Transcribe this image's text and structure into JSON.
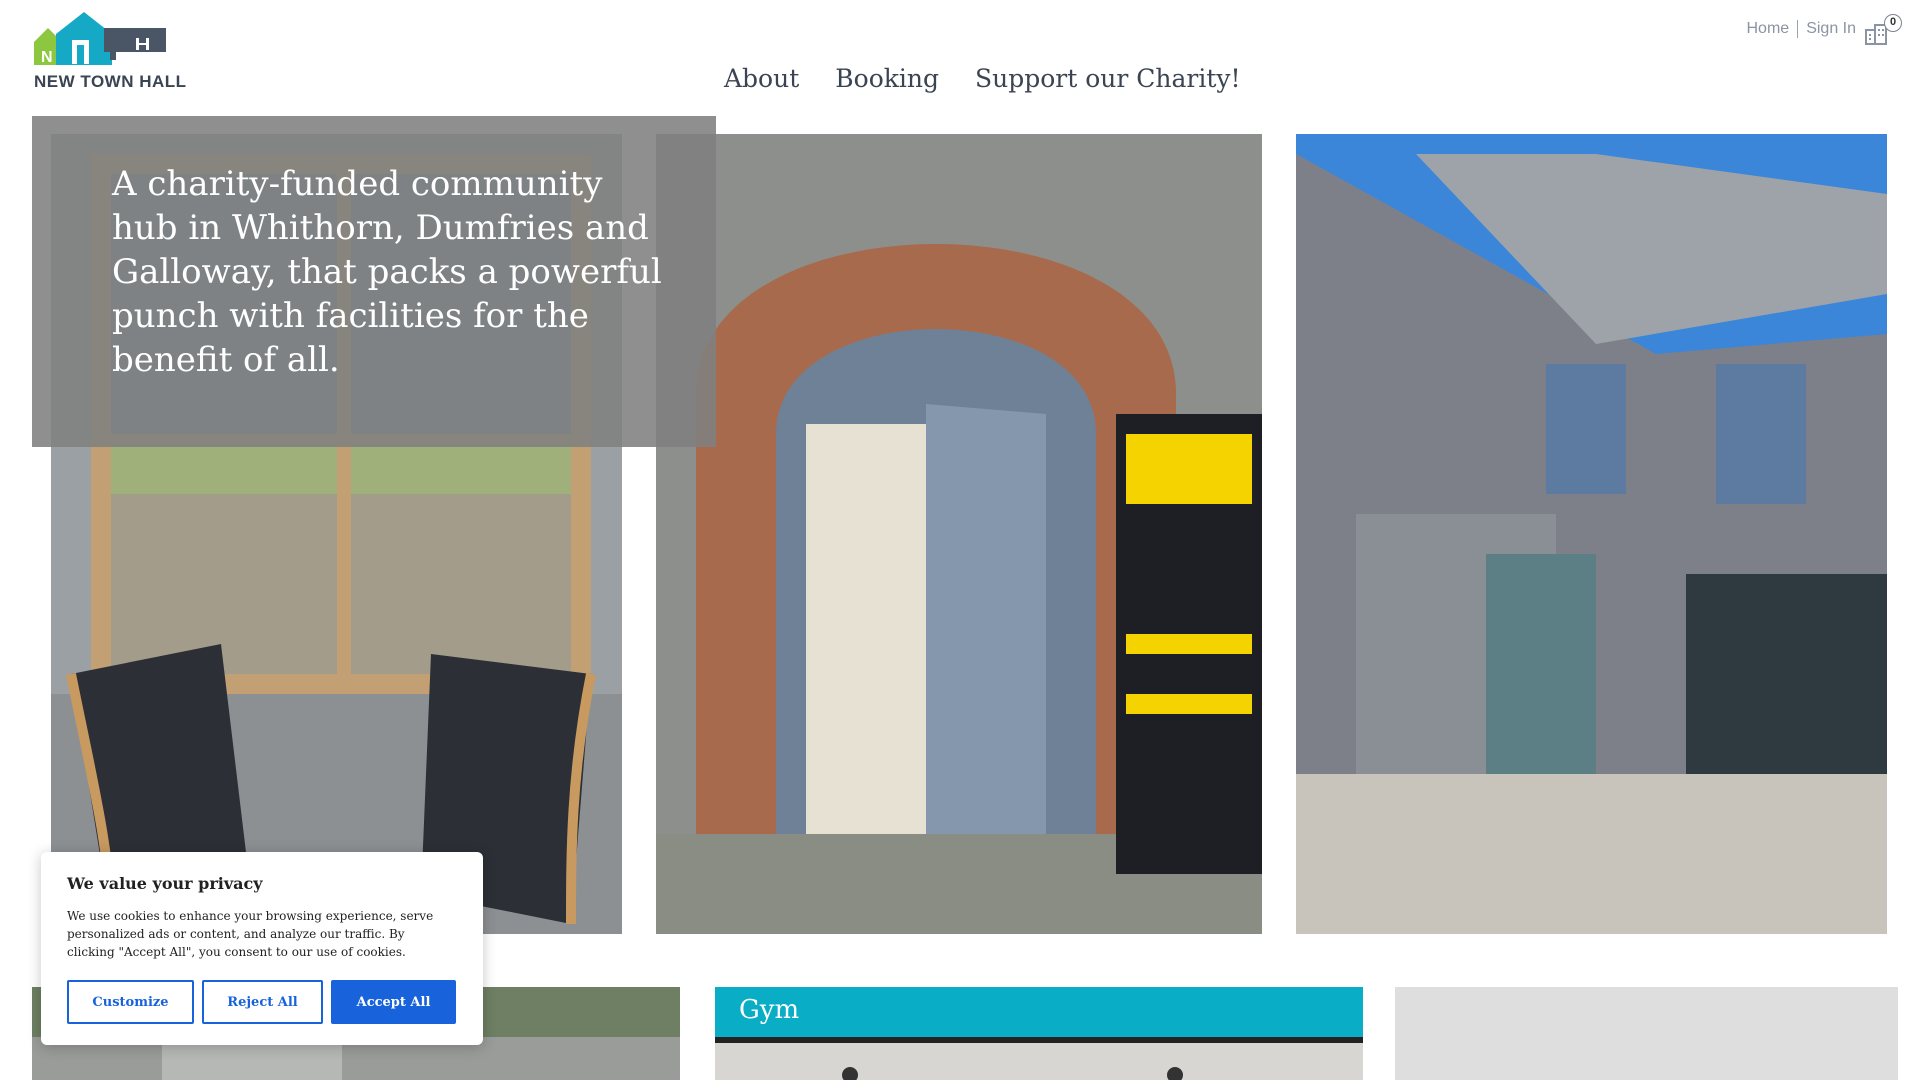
{
  "header": {
    "logo_text": "NEW TOWN HALL",
    "nav": [
      {
        "label": "About"
      },
      {
        "label": "Booking"
      },
      {
        "label": "Support our Charity!"
      }
    ],
    "util": {
      "home": "Home",
      "sign_in": "Sign In"
    },
    "cart": {
      "icon": "cart-icon",
      "count": "0"
    }
  },
  "hero": {
    "tagline": "A charity-funded community hub in Whithorn, Dumfries and Galloway, that packs a powerful punch with facilities for the benefit of all.",
    "photos": [
      {
        "icon": "room-with-chairs-photo"
      },
      {
        "icon": "arched-doorway-photo"
      },
      {
        "icon": "building-courtyard-photo"
      }
    ]
  },
  "cards": [
    {
      "title": "",
      "color": "#6e7f63"
    },
    {
      "title": "Gym",
      "color": "#09aec6"
    },
    {
      "title": "",
      "color": "#dedede"
    }
  ],
  "cookie": {
    "title": "We value your privacy",
    "text": "We use cookies to enhance your browsing experience, serve personalized ads or content, and analyze our traffic. By clicking \"Accept All\", you consent to our use of cookies.",
    "customize": "Customize",
    "reject": "Reject All",
    "accept": "Accept All",
    "accent": "#1863dc"
  },
  "colors": {
    "nav_text": "#3a4452",
    "overlay": "#808080",
    "gym_blue": "#09aec6"
  }
}
